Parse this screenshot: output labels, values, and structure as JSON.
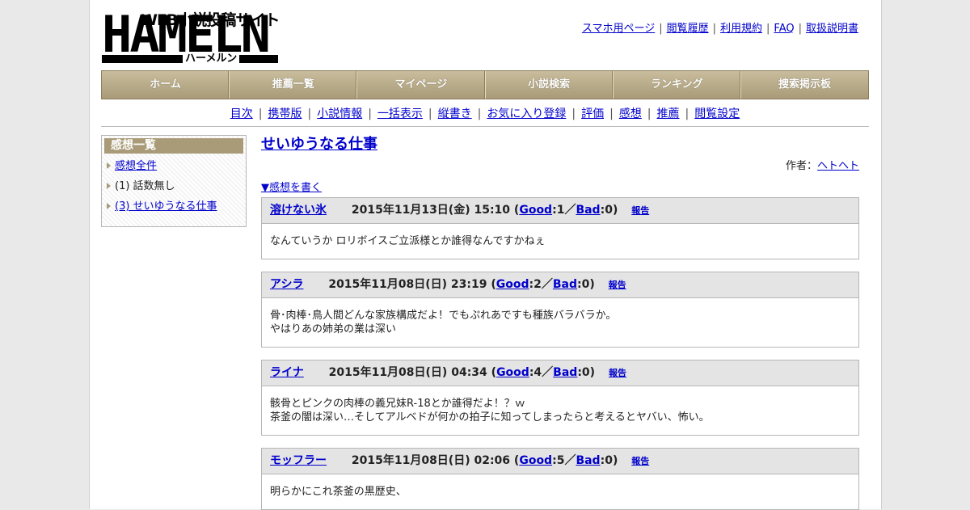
{
  "logo": {
    "tagline": "WEB小説投稿サイト",
    "wordmark": "HAMELN",
    "kana": "ハーメルン"
  },
  "top_links": [
    "スマホ用ページ",
    "閲覧履歴",
    "利用規約",
    "FAQ",
    "取扱説明書"
  ],
  "main_nav": [
    "ホーム",
    "推薦一覧",
    "マイページ",
    "小説検索",
    "ランキング",
    "捜索掲示板"
  ],
  "sub_nav": [
    "目次",
    "携帯版",
    "小説情報",
    "一括表示",
    "縦書き",
    "お気に入り登録",
    "評価",
    "感想",
    "推薦",
    "閲覧設定"
  ],
  "sidebar": {
    "title": "感想一覧",
    "items": [
      {
        "label": "感想全件",
        "link": true
      },
      {
        "label": "(1) 話数無し",
        "link": false
      },
      {
        "label": "(3) せいゆうなる仕事",
        "link": true
      }
    ]
  },
  "content": {
    "title": "せいゆうなる仕事",
    "author_label": "作者：",
    "author_name": "ヘトヘト",
    "write_link": "▼感想を書く",
    "reviews": [
      {
        "name": "溶けない氷",
        "date": "2015年11月13日(金) 15:10",
        "good": "1",
        "bad": "0",
        "lines": [
          "なんていうか ロリボイスご立派様とか誰得なんですかねぇ"
        ]
      },
      {
        "name": "アシラ",
        "date": "2015年11月08日(日) 23:19",
        "good": "2",
        "bad": "0",
        "lines": [
          "骨･肉棒･鳥人間どんな家族構成だよ！でもぷれあですも種族バラバラか。",
          "やはりあの姉弟の業は深い"
        ]
      },
      {
        "name": "ライナ",
        "date": "2015年11月08日(日) 04:34",
        "good": "4",
        "bad": "0",
        "lines": [
          "骸骨とピンクの肉棒の義兄妹R-18とか誰得だよ！？ｗ",
          "茶釜の闇は深い…そしてアルベドが何かの拍子に知ってしまったらと考えるとヤバい、怖い。"
        ]
      },
      {
        "name": "モッフラー",
        "date": "2015年11月08日(日) 02:06",
        "good": "5",
        "bad": "0",
        "lines": [
          "明らかにこれ茶釜の黒歴史、"
        ]
      }
    ],
    "good_label": "Good",
    "bad_label": "Bad",
    "report_label": "報告"
  }
}
